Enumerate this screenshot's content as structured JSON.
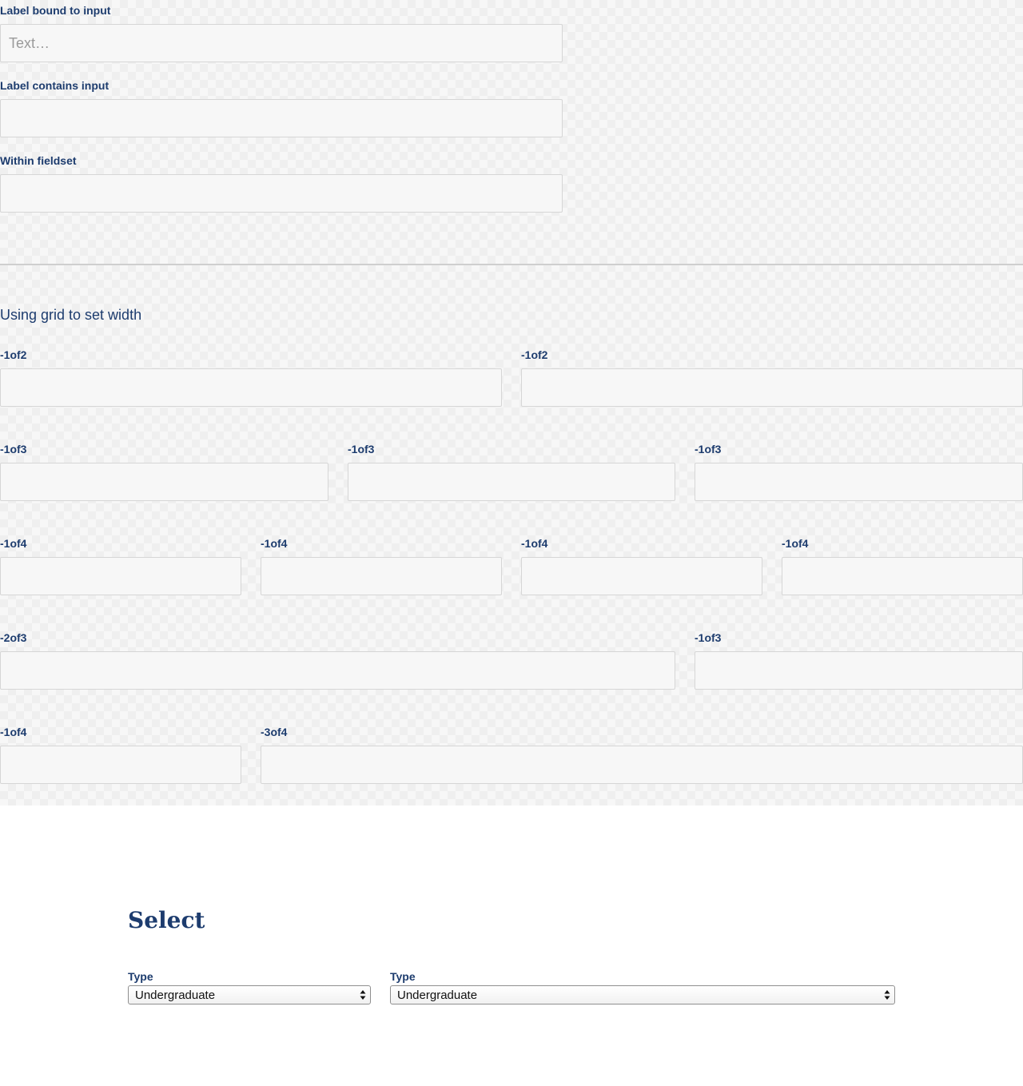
{
  "text_inputs": {
    "label_bound": "Label bound to input",
    "label_bound_placeholder": "Text…",
    "label_contains": "Label contains input",
    "within_fieldset": "Within fieldset"
  },
  "grid": {
    "heading": "Using grid to set width",
    "row1": [
      "-1of2",
      "-1of2"
    ],
    "row2": [
      "-1of3",
      "-1of3",
      "-1of3"
    ],
    "row3": [
      "-1of4",
      "-1of4",
      "-1of4",
      "-1of4"
    ],
    "row4": [
      "-2of3",
      "-1of3"
    ],
    "row5": [
      "-1of4",
      "-3of4"
    ]
  },
  "select_section": {
    "title": "Select",
    "select1": {
      "label": "Type",
      "value": "Undergraduate"
    },
    "select2": {
      "label": "Type",
      "value": "Undergraduate"
    }
  },
  "colors": {
    "label": "#1d3c6e",
    "input_bg": "#f7f7f7",
    "input_border": "#d6d6d6"
  }
}
